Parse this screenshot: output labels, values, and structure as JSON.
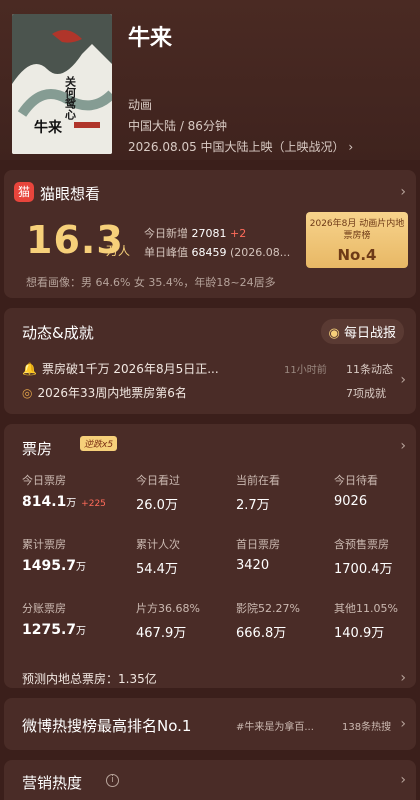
{
  "movie": {
    "title": "牛来",
    "genre": "动画",
    "region_duration": "中国大陆 / 86分钟",
    "release": "2026.08.05 中国大陆上映（上映",
    "release_link": "战况）",
    "poster_text": "牛来",
    "poster_calligraphy": "关何鸳心"
  },
  "maoyan": {
    "logo": "猫",
    "title": "猫眼想看",
    "want_value": "16.3",
    "want_unit": "万人",
    "today_new_label": "今日新增",
    "today_new_value": "27081",
    "today_new_delta": "+2",
    "peak_label": "单日峰值",
    "peak_value": "68459",
    "peak_date": "(2026.08...",
    "rank_title": "2026年8月 动画片内地票房榜",
    "rank_value": "No.4",
    "portrait": "想看画像：男 64.6%  女 35.4%，年龄18~24居多"
  },
  "dynamics": {
    "title": "动态&成就",
    "daily_label": "每日战报",
    "items": [
      {
        "text": "票房破1千万 2026年8月5日正...",
        "time": "11小时前",
        "count": "11条动态"
      },
      {
        "text": "2026年33周内地票房第6名",
        "time": "",
        "count": "7项成就"
      }
    ]
  },
  "boxoffice": {
    "title": "票房",
    "reverse_badge": "逆跌x5",
    "cells": [
      {
        "label": "今日票房",
        "value": "814.1",
        "unit": "万",
        "delta": "+225"
      },
      {
        "label": "今日看过",
        "value": "26.0万"
      },
      {
        "label": "当前在看",
        "value": "2.7万"
      },
      {
        "label": "今日待看",
        "value": "9026"
      },
      {
        "label": "累计票房",
        "value": "1495.7",
        "unit": "万"
      },
      {
        "label": "累计人次",
        "value": "54.4万"
      },
      {
        "label": "首日票房",
        "value": "3420"
      },
      {
        "label": "含预售票房",
        "value": "1700.4万"
      },
      {
        "label": "分账票房",
        "value": "1275.7",
        "unit": "万"
      },
      {
        "label": "片方36.68%",
        "value": "467.9万"
      },
      {
        "label": "影院52.27%",
        "value": "666.8万"
      },
      {
        "label": "其他11.05%",
        "value": "140.9万"
      }
    ],
    "predict": "预测内地总票房：1.35亿"
  },
  "weibo": {
    "title": "微博热搜榜最高排名No.1",
    "tag": "#牛来是为拿百...",
    "count": "138条热搜"
  },
  "marketing": {
    "title": "营销热度",
    "info": "i"
  },
  "colors": {
    "background": "#3b1f1b",
    "card": "#4a2c27",
    "gold": "#f6d07a",
    "up": "#ff6b5a"
  }
}
